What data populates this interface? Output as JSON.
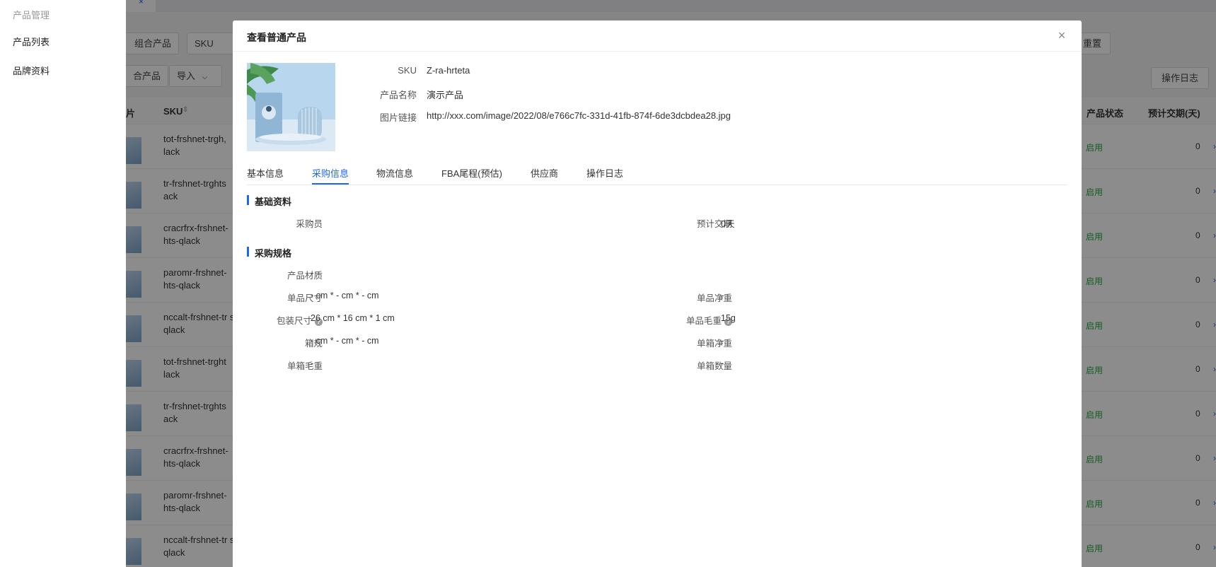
{
  "sidebar": {
    "group_label": "产品管理",
    "items": [
      {
        "label": "产品列表"
      },
      {
        "label": "品牌资料"
      }
    ]
  },
  "background": {
    "tab_close": "×",
    "filter_pills": [
      "组合产品",
      "SKU"
    ],
    "action_pills": [
      "合产品",
      "导入"
    ],
    "reset_label": "重置",
    "oplog_label": "操作日志",
    "headers": {
      "image": "片",
      "sku": "SKU",
      "status": "产品状态",
      "leadtime": "预计交期(天)"
    },
    "rows": [
      {
        "sku": "tot-frshnet-trgh, lack",
        "status": "启用",
        "lead": "0"
      },
      {
        "sku": "tr-frshnet-trghts ack",
        "status": "启用",
        "lead": "0"
      },
      {
        "sku": "cracrfrx-frshnet- hts-qlack",
        "status": "启用",
        "lead": "0"
      },
      {
        "sku": "paromr-frshnet- hts-qlack",
        "status": "启用",
        "lead": "0"
      },
      {
        "sku": "nccalt-frshnet-tr s-qlack",
        "status": "启用",
        "lead": "0"
      },
      {
        "sku": "tot-frshnet-trght lack",
        "status": "启用",
        "lead": "0"
      },
      {
        "sku": "tr-frshnet-trghts ack",
        "status": "启用",
        "lead": "0"
      },
      {
        "sku": "cracrfrx-frshnet- hts-qlack",
        "status": "启用",
        "lead": "0"
      },
      {
        "sku": "paromr-frshnet- hts-qlack",
        "status": "启用",
        "lead": "0"
      },
      {
        "sku": "nccalt-frshnet-tr s-qlack",
        "status": "启用",
        "lead": "0"
      }
    ]
  },
  "modal": {
    "title": "查看普通产品",
    "close_icon": "×",
    "info": {
      "sku_label": "SKU",
      "sku_value": "Z-ra-hrteta",
      "name_label": "产品名称",
      "name_value": "演示产品",
      "image_label": "图片链接",
      "image_value": "http://xxx.com/image/2022/08/e766c7fc-331d-41fb-874f-6de3dcbdea28.jpg"
    },
    "tabs": [
      {
        "label": "基本信息"
      },
      {
        "label": "采购信息",
        "active": true
      },
      {
        "label": "物流信息"
      },
      {
        "label": "FBA尾程(预估)"
      },
      {
        "label": "供应商"
      },
      {
        "label": "操作日志"
      }
    ],
    "sections": {
      "basic": {
        "title": "基础资料",
        "buyer_label": "采购员",
        "buyer_value": "-",
        "leadtime_label": "预计交期",
        "leadtime_value": "0天"
      },
      "spec": {
        "title": "采购规格",
        "material_label": "产品材质",
        "material_value": "-",
        "unit_size_label": "单品尺寸",
        "unit_size_value": "- cm * - cm * - cm",
        "unit_net_label": "单品净重",
        "unit_net_value": "-",
        "pack_size_label": "包装尺寸",
        "pack_size_value": "26 cm * 16 cm * 1 cm",
        "unit_gross_label": "单品毛重",
        "unit_gross_value": "15g",
        "carton_label": "箱规",
        "carton_value": "- cm * - cm * - cm",
        "carton_net_label": "单箱净重",
        "carton_net_value": "-",
        "carton_gross_label": "单箱毛重",
        "carton_gross_value": "-",
        "carton_qty_label": "单箱数量",
        "carton_qty_value": "-"
      }
    },
    "help_glyph": "?"
  },
  "colors": {
    "accent": "#1a66ff",
    "status_green": "#27a844",
    "mask": "rgba(0,0,0,0.45)"
  }
}
